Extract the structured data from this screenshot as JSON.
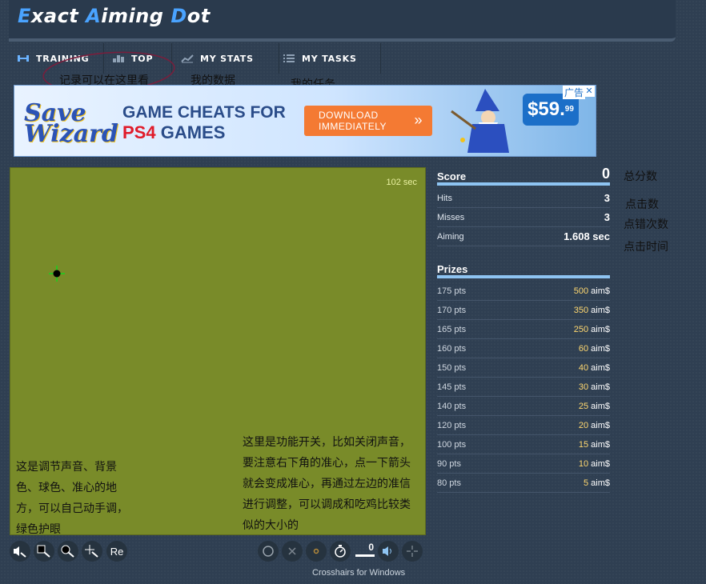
{
  "app": {
    "logo": {
      "p1_cap": "E",
      "p1_rest": "xact ",
      "p2_cap": "A",
      "p2_rest": "iming ",
      "p3_cap": "D",
      "p3_rest": "ot"
    }
  },
  "nav": {
    "items": [
      {
        "label": "TRAINING",
        "icon": "dumbbell-icon"
      },
      {
        "label": "TOP",
        "icon": "podium-icon"
      },
      {
        "label": "MY STATS",
        "icon": "chart-icon"
      },
      {
        "label": "MY TASKS",
        "icon": "list-icon"
      }
    ],
    "annotations": {
      "top": "记录可以在这里看",
      "stats": "我的数据",
      "tasks": "我的任务"
    }
  },
  "ad": {
    "brand": "Save Wizard",
    "headline1": "GAME CHEATS FOR",
    "headline2_red": "PS4",
    "headline2_rest": " GAMES",
    "button_l1": "DOWNLOAD",
    "button_l2": "IMMEDIATELY",
    "button_arrow": "»",
    "price": "$59.",
    "price_cents": "99",
    "tag": "广告",
    "close": "✕"
  },
  "game": {
    "timer": "102 sec",
    "note_left": "这是调节声音、背景色、球色、准心的地方，可以自己动手调，绿色护眼",
    "note_right": "这里是功能开关，比如关闭声音，要注意右下角的准心，点一下箭头就会变成准心，再通过左边的准信进行调整，可以调成和吃鸡比较类似的大小的",
    "bg_color": "#798b29"
  },
  "toolbar": {
    "left": [
      "sound-settings-icon",
      "bg-color-settings-icon",
      "ball-color-settings-icon",
      "crosshair-settings-icon"
    ],
    "reset_label": "Re",
    "right_value": "0",
    "footer_link": "Crosshairs for Windows"
  },
  "stats": {
    "score_label": "Score",
    "score_value": "0",
    "rows": [
      {
        "label": "Hits",
        "value": "3"
      },
      {
        "label": "Misses",
        "value": "3"
      },
      {
        "label": "Aiming",
        "value": "1.608 sec"
      }
    ],
    "notes": {
      "score": "总分数",
      "hits": "点击数",
      "misses": "点错次数",
      "aiming": "点击时间"
    }
  },
  "prizes": {
    "title": "Prizes",
    "unit": "aim$",
    "rows": [
      {
        "pts": "175 pts",
        "amt": "500"
      },
      {
        "pts": "170 pts",
        "amt": "350"
      },
      {
        "pts": "165 pts",
        "amt": "250"
      },
      {
        "pts": "160 pts",
        "amt": "60"
      },
      {
        "pts": "150 pts",
        "amt": "40"
      },
      {
        "pts": "145 pts",
        "amt": "30"
      },
      {
        "pts": "140 pts",
        "amt": "25"
      },
      {
        "pts": "120 pts",
        "amt": "20"
      },
      {
        "pts": "100 pts",
        "amt": "15"
      },
      {
        "pts": "90 pts",
        "amt": "10"
      },
      {
        "pts": "80 pts",
        "amt": "5"
      }
    ]
  }
}
